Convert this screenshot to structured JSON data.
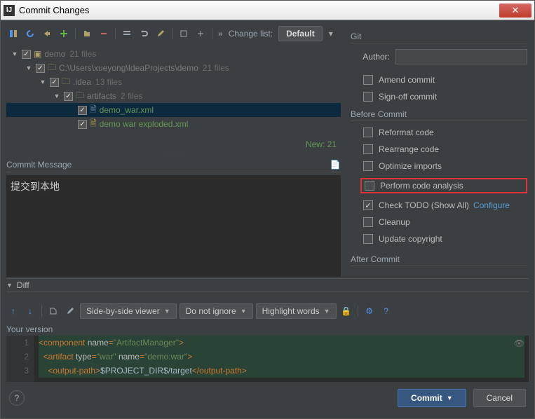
{
  "window": {
    "title": "Commit Changes"
  },
  "toolbar": {
    "change_list_label": "Change list:",
    "change_list_value": "Default"
  },
  "tree": {
    "root": {
      "label": "demo",
      "count": "21 files"
    },
    "path": {
      "label": "C:\\Users\\xueyong\\IdeaProjects\\demo",
      "count": "21 files"
    },
    "idea": {
      "label": ".idea",
      "count": "13 files"
    },
    "artifacts": {
      "label": "artifacts",
      "count": "2 files"
    },
    "file1": {
      "label": "demo_war.xml"
    },
    "file2": {
      "label": "demo war exploded.xml"
    },
    "new_count": "New: 21"
  },
  "commit_msg": {
    "label": "Commit Message",
    "value": "提交到本地"
  },
  "git": {
    "section": "Git",
    "author_label": "Author:",
    "author_value": "",
    "amend": "Amend commit",
    "signoff": "Sign-off commit"
  },
  "before": {
    "section": "Before Commit",
    "reformat": "Reformat code",
    "rearrange": "Rearrange code",
    "optimize": "Optimize imports",
    "analysis": "Perform code analysis",
    "todo": "Check TODO (Show All)",
    "todo_link": "Configure",
    "cleanup": "Cleanup",
    "copyright": "Update copyright"
  },
  "after": {
    "section": "After Commit"
  },
  "diff": {
    "label": "Diff",
    "viewer": "Side-by-side viewer",
    "ignore": "Do not ignore",
    "highlight": "Highlight words",
    "version_label": "Your version"
  },
  "footer": {
    "commit": "Commit",
    "cancel": "Cancel"
  },
  "chart_data": null
}
